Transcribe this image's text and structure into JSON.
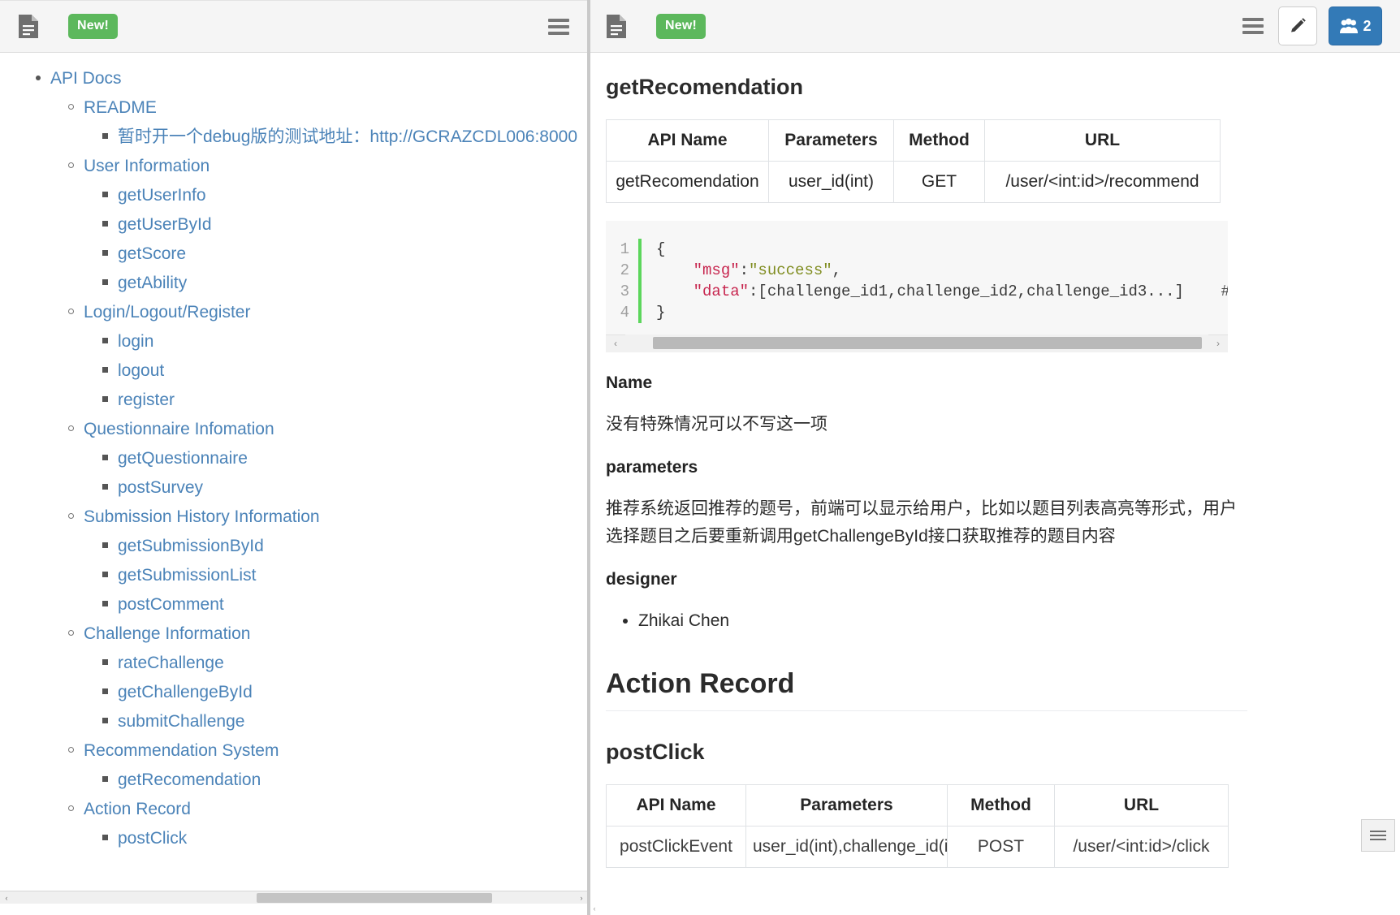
{
  "left_toolbar": {
    "doc_icon": "document-icon",
    "new_badge": "New!",
    "menu_icon": "hamburger-menu-icon"
  },
  "right_toolbar": {
    "collapse_icon": "hamburger-menu-icon",
    "doc_icon": "document-icon",
    "new_badge": "New!",
    "menu_icon": "hamburger-menu-icon",
    "edit_icon": "pencil-icon",
    "users_icon": "users-icon",
    "users_count": "2",
    "users_btn_color": "#337ab7",
    "badge_color": "#5cb85c"
  },
  "outline": {
    "root": "API Docs",
    "sections": [
      {
        "title": "README",
        "items": [
          "暂时开一个debug版的测试地址：http://GCRAZCDL006:8000"
        ]
      },
      {
        "title": "User Information",
        "items": [
          "getUserInfo",
          "getUserById",
          "getScore",
          "getAbility"
        ]
      },
      {
        "title": "Login/Logout/Register",
        "items": [
          "login",
          "logout",
          "register"
        ]
      },
      {
        "title": "Questionnaire Infomation",
        "items": [
          "getQuestionnaire",
          "postSurvey"
        ]
      },
      {
        "title": "Submission History Information",
        "items": [
          "getSubmissionById",
          "getSubmissionList",
          "postComment"
        ]
      },
      {
        "title": "Challenge Information",
        "items": [
          "rateChallenge",
          "getChallengeById",
          "submitChallenge"
        ]
      },
      {
        "title": "Recommendation System",
        "items": [
          "getRecomendation"
        ]
      },
      {
        "title": "Action Record",
        "items": [
          "postClick"
        ]
      }
    ]
  },
  "document": {
    "heading_getrecomendation": "getRecomendation",
    "table_headers": [
      "API Name",
      "Parameters",
      "Method",
      "URL"
    ],
    "table_row": [
      "getRecomendation",
      "user_id(int)",
      "GET",
      "/user/<int:id>/recommend"
    ],
    "code": {
      "lines": [
        {
          "n": "1",
          "segments": [
            {
              "t": "{",
              "c": "pun"
            }
          ]
        },
        {
          "n": "2",
          "segments": [
            {
              "t": "    ",
              "c": "pun"
            },
            {
              "t": "\"msg\"",
              "c": "key"
            },
            {
              "t": ":",
              "c": "pun"
            },
            {
              "t": "\"success\"",
              "c": "str"
            },
            {
              "t": ",",
              "c": "pun"
            }
          ]
        },
        {
          "n": "3",
          "segments": [
            {
              "t": "    ",
              "c": "pun"
            },
            {
              "t": "\"data\"",
              "c": "key"
            },
            {
              "t": ":[challenge_id1,challenge_id2,challenge_id3...]",
              "c": "pun"
            },
            {
              "t": "    # 推荐的题号",
              "c": "com"
            }
          ]
        },
        {
          "n": "4",
          "segments": [
            {
              "t": "}",
              "c": "pun"
            }
          ]
        }
      ]
    },
    "section_name_label": "Name",
    "section_name_text": "没有特殊情况可以不写这一项",
    "section_params_label": "parameters",
    "section_params_text": "推荐系统返回推荐的题号，前端可以显示给用户，比如以题目列表高亮等形式，用户选择题目之后要重新调用getChallengeById接口获取推荐的题目内容",
    "section_designer_label": "designer",
    "designers": [
      "Zhikai Chen"
    ],
    "heading_action_record": "Action Record",
    "heading_postclick": "postClick",
    "postclick_table_headers": [
      "API Name",
      "Parameters",
      "Method",
      "URL"
    ],
    "postclick_table_row": [
      "postClickEvent",
      "user_id(int),challenge_id(int)",
      "POST",
      "/user/<int:id>/click"
    ]
  },
  "scroll": {
    "left_arrow": "‹",
    "right_arrow": "›"
  }
}
